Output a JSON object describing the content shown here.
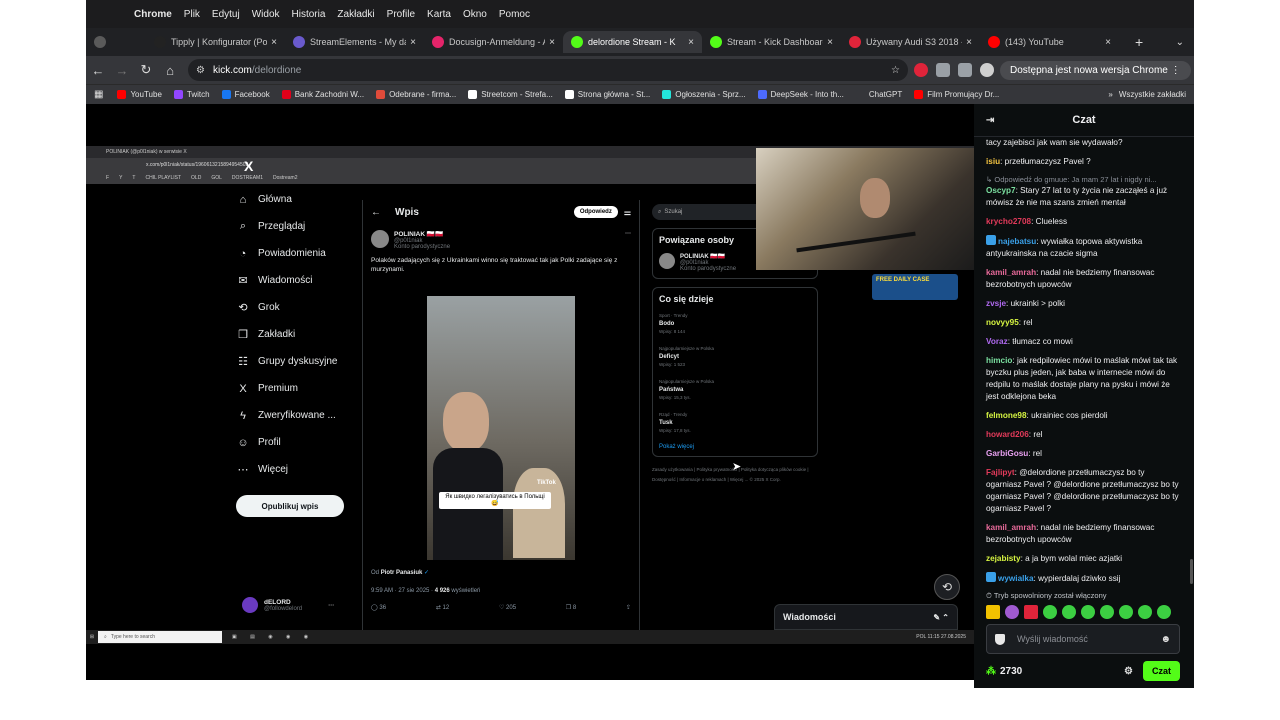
{
  "menubar": {
    "app": "Chrome",
    "items": [
      "Plik",
      "Edytuj",
      "Widok",
      "Historia",
      "Zakładki",
      "Profile",
      "Karta",
      "Okno",
      "Pomoc"
    ]
  },
  "tabs": [
    {
      "title": "",
      "color": "#5a5a5a",
      "active": false
    },
    {
      "title": "Tipply | Konfigurator (Po",
      "color": "#222222",
      "active": false
    },
    {
      "title": "StreamElements - My da",
      "color": "#6a5acd",
      "active": false
    },
    {
      "title": "Docusign-Anmeldung - A",
      "color": "#e5246a",
      "active": false
    },
    {
      "title": "delordione Stream - K",
      "color": "#53fc18",
      "active": true
    },
    {
      "title": "Stream - Kick Dashboard",
      "color": "#53fc18",
      "active": false
    },
    {
      "title": "Używany Audi S3 2018 -",
      "color": "#e0243a",
      "active": false
    },
    {
      "title": "(143) YouTube",
      "color": "#ff0000",
      "active": false
    }
  ],
  "toolbar": {
    "url_host": "kick.com",
    "url_path": "/delordione",
    "update_label": "Dostępna jest nowa wersja Chrome"
  },
  "bookmarks": [
    {
      "label": "YouTube",
      "color": "#ff0000"
    },
    {
      "label": "Twitch",
      "color": "#9146ff"
    },
    {
      "label": "Facebook",
      "color": "#1877f2"
    },
    {
      "label": "Bank Zachodni W...",
      "color": "#e2001a"
    },
    {
      "label": "Odebrane - firma...",
      "color": "#e04b3a"
    },
    {
      "label": "Streetcom - Strefa...",
      "color": "#ffffff"
    },
    {
      "label": "Strona główna - St...",
      "color": "#ffffff"
    },
    {
      "label": "Ogłoszenia - Sprz...",
      "color": "#23e5db"
    },
    {
      "label": "DeepSeek - Into th...",
      "color": "#4d6bfe"
    },
    {
      "label": "ChatGPT",
      "color": "#35363a"
    },
    {
      "label": "Film Promujący Dr...",
      "color": "#ff0000"
    }
  ],
  "bookmarks_all": "Wszystkie zakładki",
  "inner": {
    "tab_title": "POLINIAK (@p0l1niak) w serwisie X",
    "url": "x.com/p0l1niak/status/1960613215894954502",
    "bookmarks": [
      "F",
      "Y",
      "T",
      "CHIL PLAYLIST",
      "OLD",
      "GOL",
      "DOSTREAM1",
      "Dostream2"
    ],
    "nav": [
      {
        "icon": "⌂",
        "label": "Główna",
        "name": "home"
      },
      {
        "icon": "⌕",
        "label": "Przeglądaj",
        "name": "explore"
      },
      {
        "icon": "◔",
        "label": "Powiadomienia",
        "name": "notifications"
      },
      {
        "icon": "✉",
        "label": "Wiadomości",
        "name": "messages"
      },
      {
        "icon": "⟲",
        "label": "Grok",
        "name": "grok"
      },
      {
        "icon": "❒",
        "label": "Zakładki",
        "name": "bookmarks"
      },
      {
        "icon": "☷",
        "label": "Grupy dyskusyjne",
        "name": "communities"
      },
      {
        "icon": "X",
        "label": "Premium",
        "name": "premium"
      },
      {
        "icon": "ϟ",
        "label": "Zweryfikowane ...",
        "name": "verified"
      },
      {
        "icon": "☺",
        "label": "Profil",
        "name": "profile"
      },
      {
        "icon": "⋯",
        "label": "Więcej",
        "name": "more"
      }
    ],
    "post_button": "Opublikuj wpis",
    "user": {
      "name": "dELORD",
      "handle": "@followdelord"
    },
    "wpis_title": "Wpis",
    "reply_label": "Odpowiedz",
    "author": {
      "name": "POLINIAK 🇵🇱🇵🇱",
      "handle": "@p0l1niak",
      "note": "Konto parodystyczne"
    },
    "tweet_text": "Polaków zadających się z Ukrainkami winno się traktować tak jak Polki zadające się z murzynami.",
    "media_caption": "Як швидко легалізуватись в Польщі 😅",
    "media_brand": "TikTok",
    "from_label": "Od",
    "from_name": "Piotr Panasiuk",
    "meta": "9:59 AM · 27 sie 2025 · ",
    "views_count": "4 926",
    "views_label": " wyświetleń",
    "actions": [
      "36",
      "12",
      "205",
      "8"
    ],
    "search_placeholder": "Szukaj",
    "related_title": "Powiązane osoby",
    "related": {
      "name": "POLINIAK 🇵🇱🇵🇱",
      "handle": "@p0l1niak",
      "note": "Konto parodystyczne"
    },
    "trends_title": "Co się dzieje",
    "trends": [
      {
        "cat": "Sport · Trendy",
        "name": "Bodo",
        "count": "Wpisy: 8 144"
      },
      {
        "cat": "Najpopularniejsze w Polska",
        "name": "Deficyt",
        "count": "Wpisy: 1 523"
      },
      {
        "cat": "Najpopularniejsze w Polska",
        "name": "Państwa",
        "count": "Wpisy: 15,3 tys."
      },
      {
        "cat": "Rząd · Trendy",
        "name": "Tusk",
        "count": "Wpisy: 17,8 tys."
      }
    ],
    "show_more": "Pokaż więcej",
    "footer": "Zasady użytkowania | Polityka prywatności | Polityka dotycząca plików cookie | Dostępność | Informacje o reklamach | Więcej ... © 2025 X Corp.",
    "messages_panel": "Wiadomości",
    "taskbar_search": "Type here to search",
    "tray": "POL  11:15 27.08.2025",
    "ad_text": "FREE DAILY CASE"
  },
  "chat": {
    "title": "Czat",
    "messages": [
      {
        "user": "",
        "color": "#efeff1",
        "text": "tacy zajebisci jak wam sie wydawało?"
      },
      {
        "user": "isiu",
        "color": "#f5c542",
        "text": "przetłumaczysz Pavel ?"
      },
      {
        "reply": "↳ Odpowiedź do gmuue: Ja mam 27 lat i nigdy ni...",
        "user": "Oscyp7",
        "color": "#7be0a0",
        "text": "Stary 27 lat to ty życia nie zacząłeś a już mówisz że nie ma szans zmień mentał"
      },
      {
        "user": "krycho2708",
        "color": "#e23a5a",
        "text": "Clueless"
      },
      {
        "user": "najebatsu",
        "color": "#3aa0e8",
        "badge": true,
        "text": "wywiałka topowa aktywistka antyukrainska na czacie sigma"
      },
      {
        "user": "kamil_amrah",
        "color": "#e86a9a",
        "text": "nadal nie bedziemy finansowac bezrobotnych upowców"
      },
      {
        "user": "zvsje",
        "color": "#b06af0",
        "text": "ukrainki > polki"
      },
      {
        "user": "novyy95",
        "color": "#d7f542",
        "text": "rel"
      },
      {
        "user": "Voraz",
        "color": "#b06af0",
        "text": "tłumacz co mowi"
      },
      {
        "user": "himcio",
        "color": "#7be0a0",
        "text": "jak redpilowiec mówi to maślak mówi tak tak byczku plus jeden, jak baba w internecie mówi do redpilu to maślak dostaje plany na pysku i mówi że jest odklejona beka"
      },
      {
        "user": "felmone98",
        "color": "#d7f542",
        "text": "ukrainiec cos pierdoli"
      },
      {
        "user": "howard206",
        "color": "#e23a5a",
        "text": "rel"
      },
      {
        "user": "GarbiGosu",
        "color": "#e8a0f0",
        "text": "rel"
      },
      {
        "user": "Fajlipyt",
        "color": "#e23a5a",
        "text": "@delordione przetłumaczysz bo ty ogarniasz Pavel ? @delordione przetłumaczysz bo ty ogarniasz Pavel ? @delordione przetłumaczysz bo ty ogarniasz Pavel ?"
      },
      {
        "user": "kamil_amrah",
        "color": "#e86a9a",
        "text": "nadal nie bedziemy finansowac bezrobotnych upowców"
      },
      {
        "user": "zejabisty",
        "color": "#d7f542",
        "text": "a ja bym wolal miec azjatki"
      },
      {
        "user": "wywialka",
        "color": "#3aa0e8",
        "badge": true,
        "text": "wypierdalaj dziwko ssij"
      }
    ],
    "slow_mode": "Tryb spowolniony został włączony",
    "input_placeholder": "Wyślij wiadomość",
    "points": "2730",
    "send_label": "Czat"
  }
}
